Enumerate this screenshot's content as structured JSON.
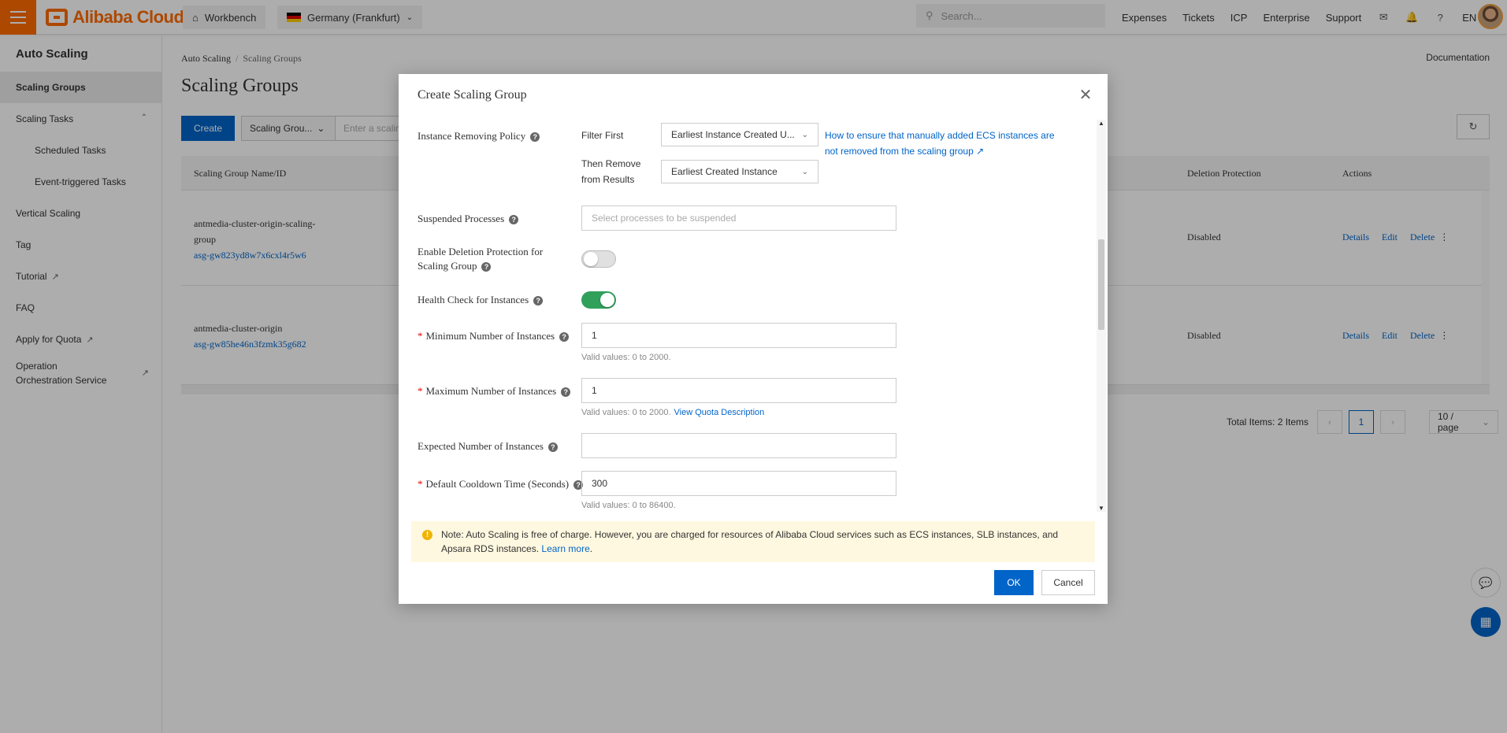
{
  "topbar": {
    "brand": "Alibaba Cloud",
    "workbench": "Workbench",
    "region": "Germany (Frankfurt)",
    "search_placeholder": "Search...",
    "links": [
      "Expenses",
      "Tickets",
      "ICP",
      "Enterprise",
      "Support"
    ],
    "lang": "EN"
  },
  "sidebar": {
    "title": "Auto Scaling",
    "items": [
      {
        "label": "Scaling Groups"
      },
      {
        "label": "Scaling Tasks"
      },
      {
        "label": "Scheduled Tasks"
      },
      {
        "label": "Event-triggered Tasks"
      },
      {
        "label": "Vertical Scaling"
      },
      {
        "label": "Tag"
      },
      {
        "label": "Tutorial"
      },
      {
        "label": "FAQ"
      },
      {
        "label": "Apply for Quota"
      },
      {
        "label": "Operation Orchestration Service"
      }
    ]
  },
  "main": {
    "breadcrumb": [
      "Auto Scaling",
      "Scaling Groups"
    ],
    "documentation": "Documentation",
    "title": "Scaling Groups",
    "create": "Create",
    "filter_select": "Scaling Grou...",
    "filter_placeholder": "Enter a scaling group name",
    "columns": [
      "Scaling Group Name/ID",
      "Deletion Protection",
      "Actions"
    ],
    "rows": [
      {
        "name": "antmedia-cluster-origin-scaling-group",
        "id": "asg-gw823yd8w7x6cxl4r5w6",
        "protection": "Disabled",
        "actions": [
          "Details",
          "Edit",
          "Delete"
        ]
      },
      {
        "name": "antmedia-cluster-origin",
        "id": "asg-gw85he46n3fzmk35g682",
        "protection": "Disabled",
        "actions": [
          "Details",
          "Edit",
          "Delete"
        ]
      }
    ],
    "pagination": {
      "total": "Total Items: 2 Items",
      "current": "1",
      "page_size": "10 / page"
    }
  },
  "dialog": {
    "title": "Create Scaling Group",
    "removing_policy": {
      "label": "Instance Removing Policy",
      "filter_first_label": "Filter First",
      "filter_first_value": "Earliest Instance Created U...",
      "then_remove_label": "Then Remove from Results",
      "then_remove_value": "Earliest Created Instance",
      "help_link": "How to ensure that manually added ECS instances are not removed from the scaling group"
    },
    "suspended": {
      "label": "Suspended Processes",
      "placeholder": "Select processes to be suspended"
    },
    "deletion_protection": {
      "label": "Enable Deletion Protection for Scaling Group",
      "on": false
    },
    "health_check": {
      "label": "Health Check for Instances",
      "on": true
    },
    "min_instances": {
      "label": "Minimum Number of Instances",
      "value": "1",
      "hint": "Valid values: 0 to 2000."
    },
    "max_instances": {
      "label": "Maximum Number of Instances",
      "value": "1",
      "hint": "Valid values: 0 to 2000.",
      "hint_link": "View Quota Description"
    },
    "expected": {
      "label": "Expected Number of Instances",
      "value": ""
    },
    "cooldown": {
      "label": "Default Cooldown Time (Seconds)",
      "value": "300",
      "hint": "Valid values: 0 to 86400."
    },
    "note": "Note: Auto Scaling is free of charge. However, you are charged for resources of Alibaba Cloud services such as ECS instances, SLB instances, and Apsara RDS instances.",
    "note_link": "Learn more",
    "ok": "OK",
    "cancel": "Cancel"
  },
  "colors": {
    "accent": "#0064c8",
    "brand": "#ff6a00",
    "toggle_on": "#31a05b"
  }
}
